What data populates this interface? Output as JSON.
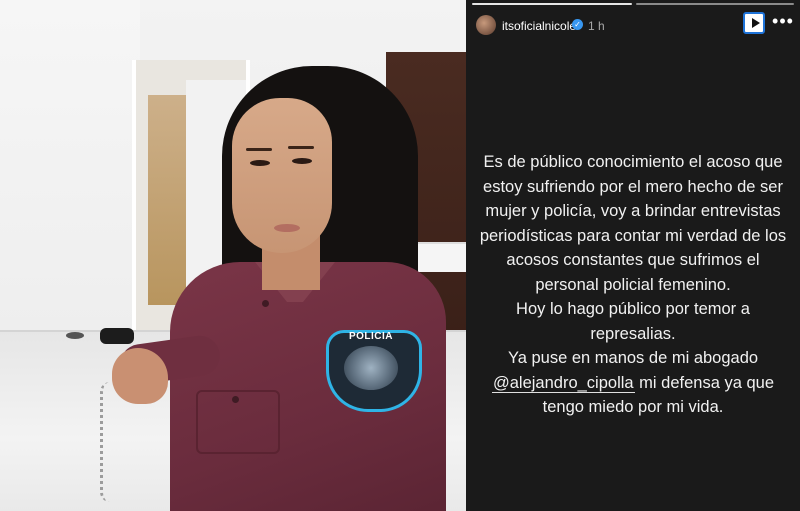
{
  "photo": {
    "patch": {
      "label": "POLICIA"
    }
  },
  "story": {
    "user": {
      "username": "itsoficialnicole",
      "verified_badge": "✓",
      "time": "1 h"
    },
    "controls": {
      "play_icon": "play-icon",
      "more_icon": "more-icon",
      "more_label": "•••"
    },
    "progress": {
      "segments": 2,
      "active_segment": 1
    },
    "lines": {
      "l1": "Es de público conocimiento el acoso que",
      "l2": "estoy sufriendo por el mero hecho de ser",
      "l3": "mujer y policía, voy a brindar entrevistas",
      "l4": "periodísticas para contar mi verdad de los",
      "l5": "acosos constantes que sufrimos el",
      "l6": "personal policial femenino.",
      "l7": "Hoy lo hago público por temor a",
      "l8": "represalias.",
      "l9": "Ya puse en manos de mi abogado",
      "l10_mention": "@alejandro_cipolla",
      "l10_rest": " mi defensa ya que",
      "l11": "tengo miedo por mi vida."
    }
  },
  "colors": {
    "panel_bg": "#1a1a1a",
    "text": "#f1f1f1",
    "verified": "#3897f0",
    "patch_border": "#2fb4e6",
    "uniform": "#6a2c3d"
  }
}
